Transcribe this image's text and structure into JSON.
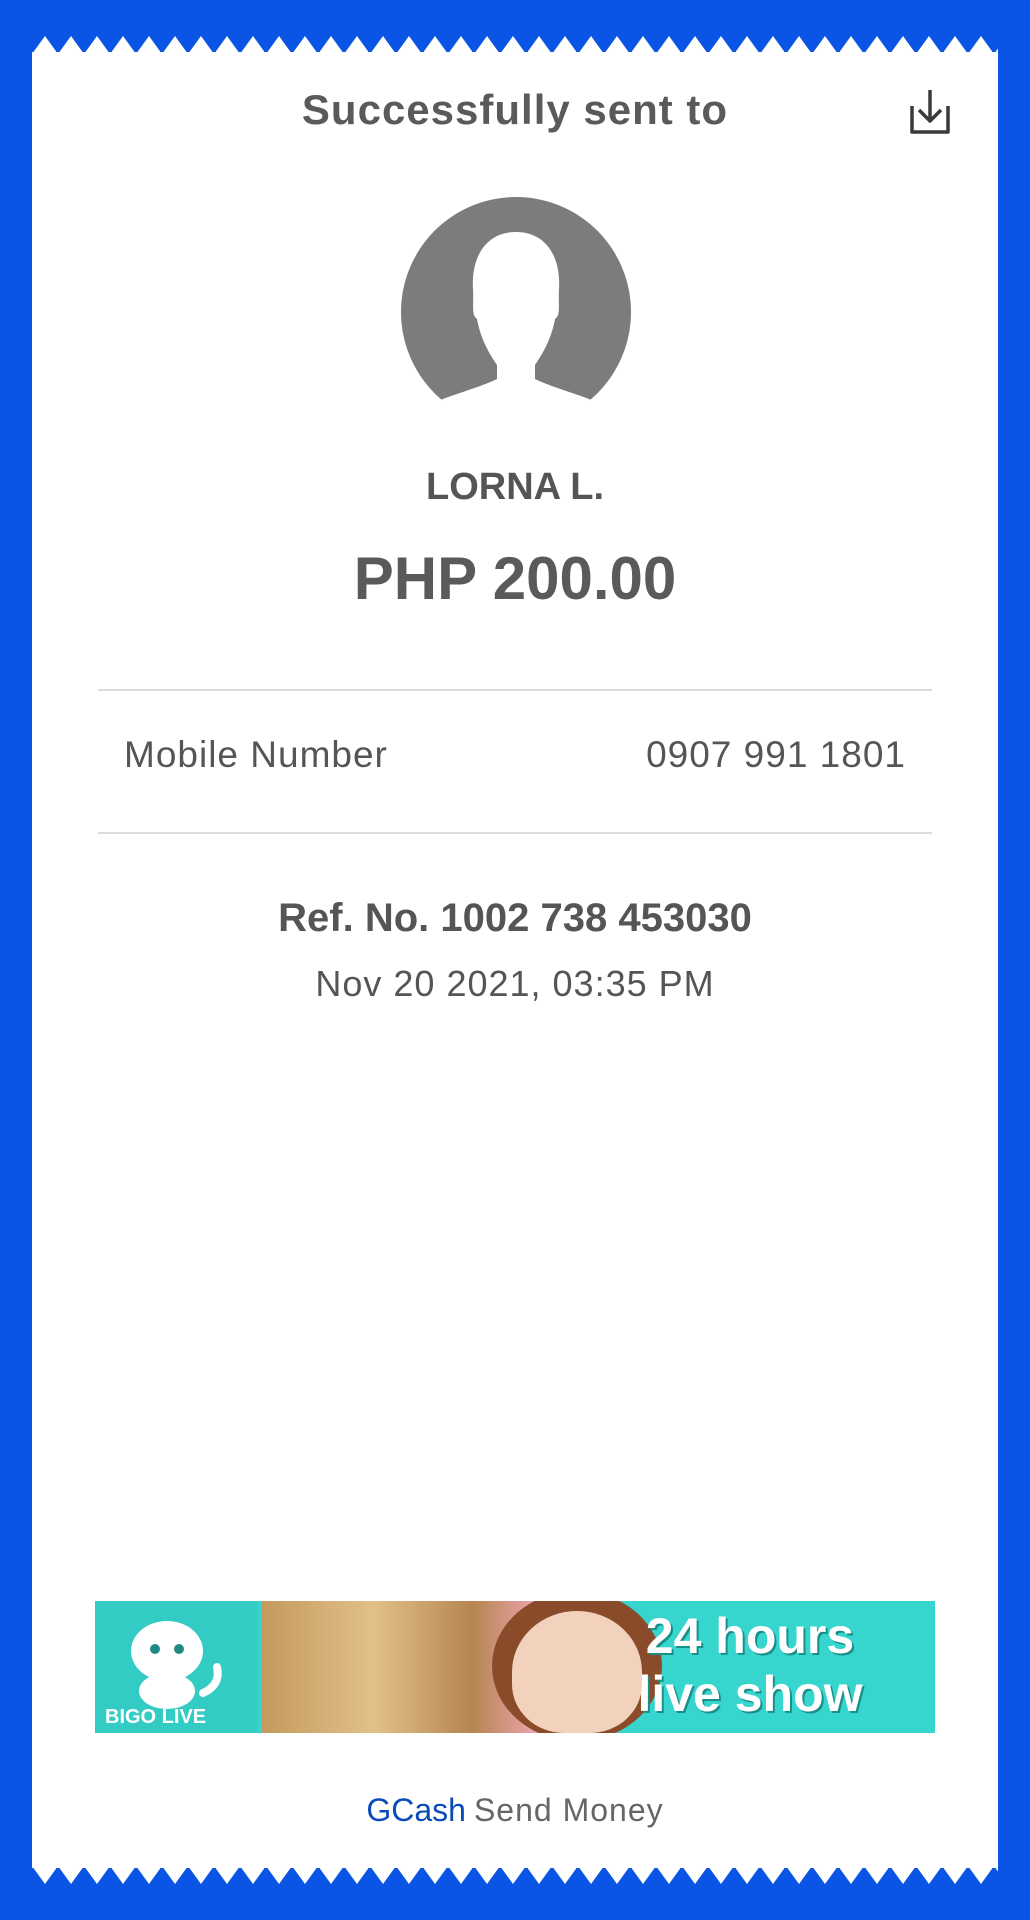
{
  "header": {
    "title": "Successfully sent to",
    "download_icon": "download-icon"
  },
  "recipient": {
    "avatar_icon": "user-avatar-icon",
    "name": "LORNA L.",
    "amount": "PHP 200.00"
  },
  "details": {
    "mobile_label": "Mobile Number",
    "mobile_value": "0907 991 1801"
  },
  "transaction": {
    "ref": "Ref. No. 1002 738 453030",
    "date": "Nov 20 2021, 03:35 PM"
  },
  "ad": {
    "brand": "BIGO LIVE",
    "headline_line1": "24 hours",
    "headline_line2": "live show"
  },
  "footer": {
    "brand": "GCash",
    "service": "Send Money"
  },
  "colors": {
    "background": "#0a55e6",
    "brand_blue": "#0a4bb8",
    "ad_teal": "#36d6cf"
  }
}
